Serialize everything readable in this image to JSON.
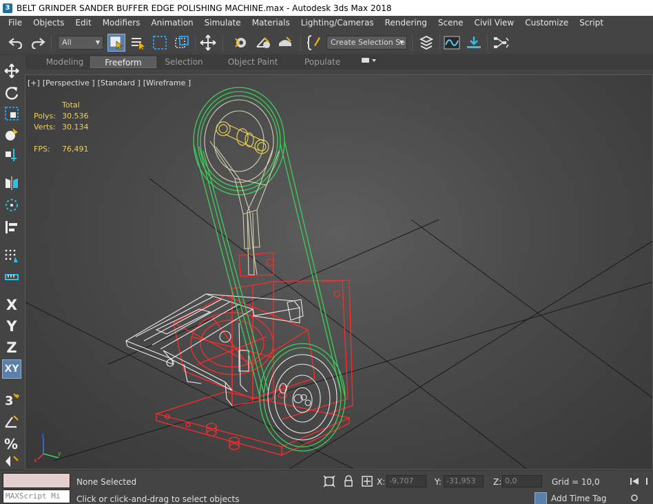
{
  "window": {
    "title": "BELT GRINDER SANDER BUFFER EDGE POLISHING MACHINE.max - Autodesk 3ds Max 2018",
    "app_icon_glyph": "3"
  },
  "menu": [
    "File",
    "Objects",
    "Edit",
    "Modifiers",
    "Animation",
    "Simulate",
    "Materials",
    "Lighting/Cameras",
    "Rendering",
    "Scene",
    "Civil View",
    "Customize",
    "Script"
  ],
  "toolbar": {
    "selection_filter": "All",
    "named_selection": "Create Selection Se",
    "icons": [
      "undo-icon",
      "redo-icon",
      "select-object-icon",
      "select-by-name-icon",
      "rectangular-region-icon",
      "window-crossing-icon",
      "move-icon",
      "snap-icon",
      "angle-snap-icon",
      "percent-snap-icon",
      "edit-named-selections-icon",
      "layer-explorer-icon",
      "curve-editor-icon",
      "align-icon",
      "schematic-icon"
    ]
  },
  "ribbon": {
    "tabs": [
      "Modeling",
      "Freeform",
      "Selection",
      "Object Paint",
      "Populate"
    ],
    "active_tab": "Freeform"
  },
  "left_toolbar": {
    "axis_labels": [
      "X",
      "Y",
      "Z",
      "XY"
    ],
    "active_axis": "XY"
  },
  "viewport": {
    "labels": [
      "[+]",
      "[Perspective ]",
      "[Standard ]",
      "[Wireframe ]"
    ],
    "stats": {
      "header": "Total",
      "polys_label": "Polys:",
      "polys_value": "30.536",
      "verts_label": "Verts:",
      "verts_value": "30.134",
      "fps_label": "FPS:",
      "fps_value": "76,491"
    },
    "gizmo_axes": [
      "x",
      "y",
      "z"
    ],
    "colors": {
      "belt": "#3ecf5a",
      "frame": "#ff2a2a",
      "arm": "#d8d0b0",
      "pulley_bolts": "#e8d050",
      "table": "#ececec",
      "grid": "#111111"
    }
  },
  "status": {
    "selection": "None Selected",
    "prompt": "Click or click-and-drag to select objects",
    "maxscript_placeholder": "MAXScript Mi",
    "x_label": "X:",
    "x_value": "-9,707",
    "y_label": "Y:",
    "y_value": "-31,953",
    "z_label": "Z:",
    "z_value": "0,0",
    "grid": "Grid = 10,0",
    "time_tag": "Add Time Tag"
  }
}
